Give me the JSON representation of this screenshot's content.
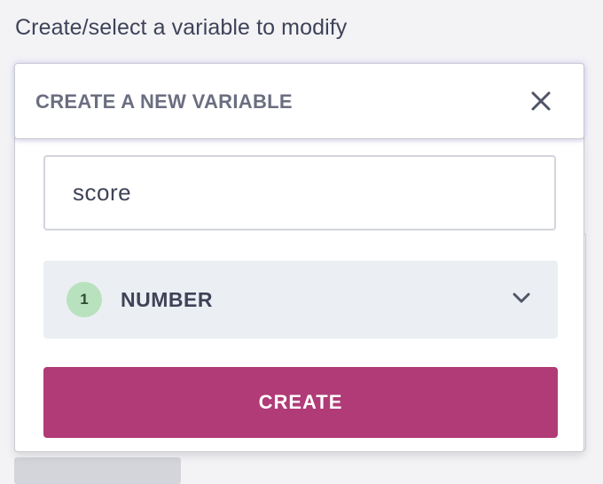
{
  "page": {
    "label": "Create/select a variable to modify"
  },
  "dropdown": {
    "title": "CREATE A NEW VARIABLE",
    "close_icon": "close-icon",
    "name_input": {
      "value": "score",
      "placeholder": ""
    },
    "type_select": {
      "badge": "1",
      "selected": "NUMBER",
      "icon": "chevron-down-icon"
    },
    "create_button": "CREATE"
  },
  "colors": {
    "accent": "#b03b77",
    "badge_bg": "#b8e2bd",
    "select_bg": "#ebeff3",
    "text": "#3f4358"
  }
}
